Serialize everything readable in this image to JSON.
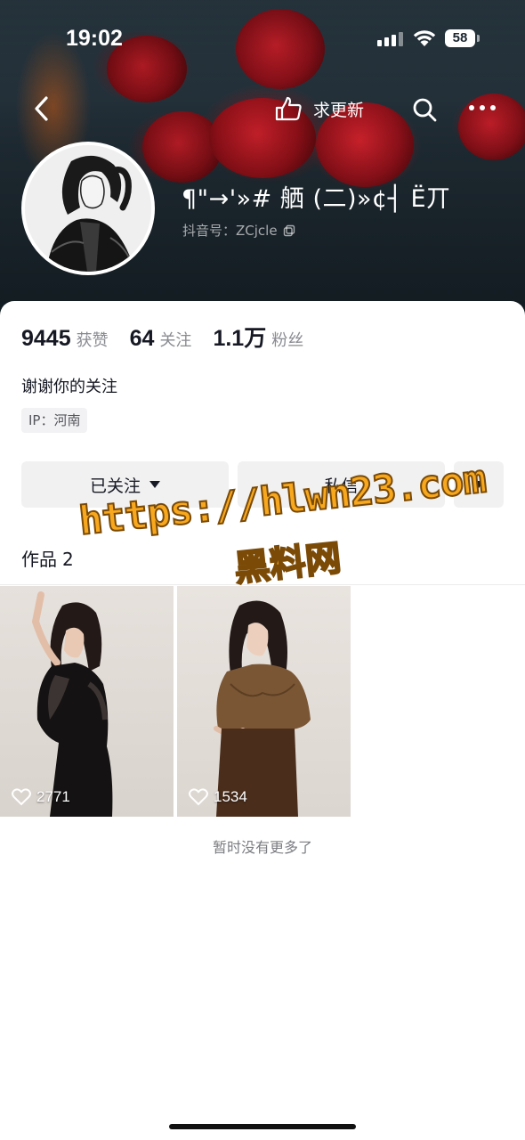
{
  "status_bar": {
    "time": "19:02",
    "battery": "58"
  },
  "top_nav": {
    "want_update_label": "求更新"
  },
  "profile": {
    "nickname": "¶\"→'»# 舾 (二)»¢┤ Ë丌",
    "douyin_id": "抖音号：ZCjcle"
  },
  "stats": [
    {
      "value": "9445",
      "label": "获赞"
    },
    {
      "value": "64",
      "label": "关注"
    },
    {
      "value": "1.1万",
      "label": "粉丝"
    }
  ],
  "bio": "谢谢你的关注",
  "ip_tag": "IP：河南",
  "actions": {
    "follow_label": "已关注",
    "message_label": "私信"
  },
  "works_tab": {
    "label": "作品",
    "count": "2"
  },
  "videos": [
    {
      "likes": "2771"
    },
    {
      "likes": "1534"
    }
  ],
  "footer_text": "暂时没有更多了",
  "watermark": {
    "url": "https://hlwn23.com",
    "site": "黑料网"
  },
  "colors": {
    "watermark": "#f7a81e",
    "muted_text": "#8a8b91",
    "button_bg": "#f1f1f2"
  }
}
